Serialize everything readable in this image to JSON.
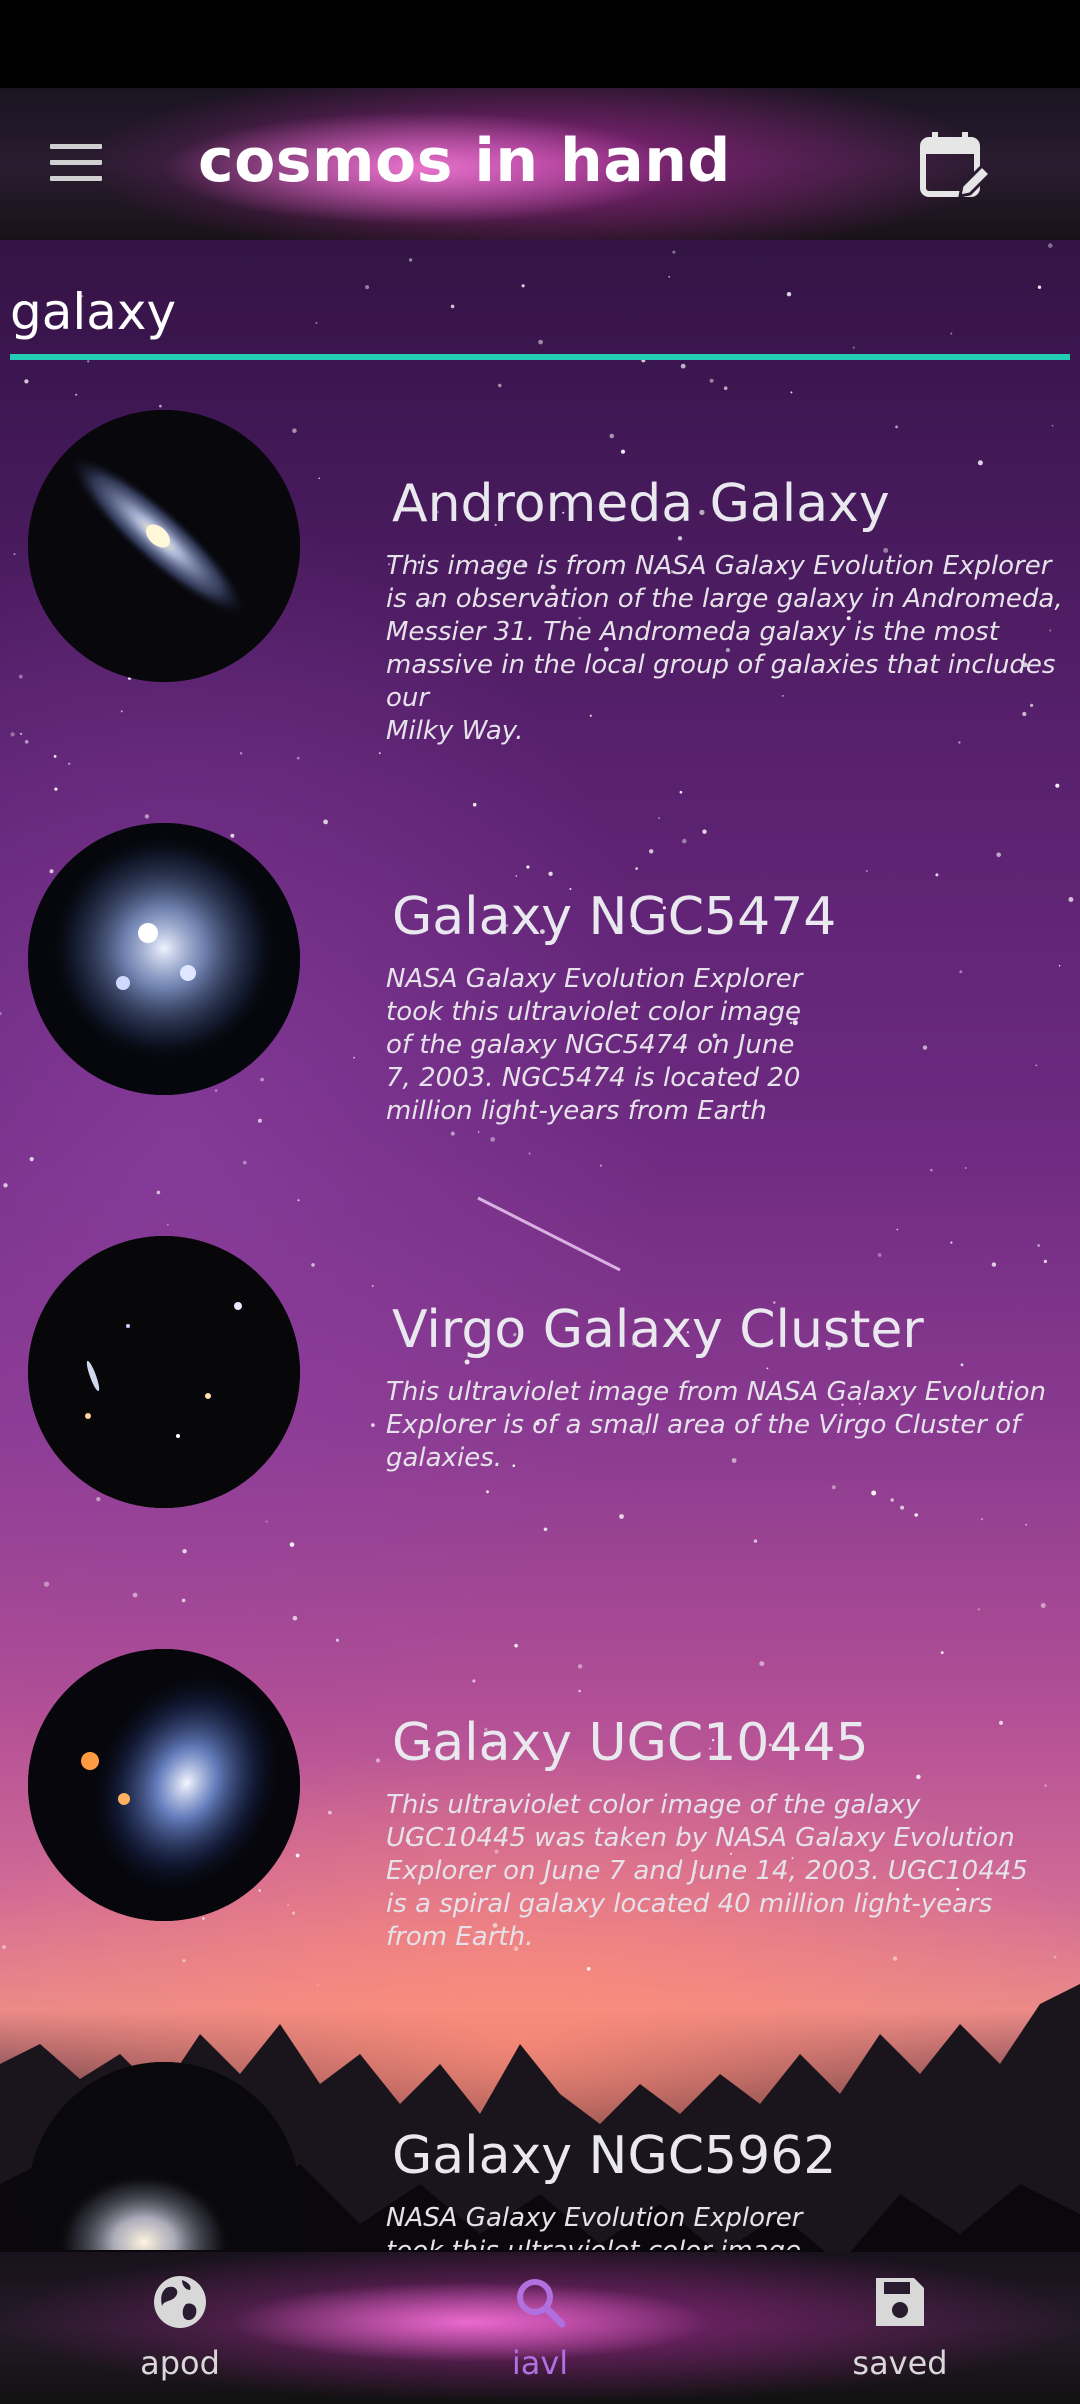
{
  "app": {
    "title": "cosmos in hand"
  },
  "search": {
    "value": "galaxy",
    "accent_color": "#22cdb4"
  },
  "results": [
    {
      "title": "Andromeda Galaxy",
      "description": "This image is from NASA Galaxy Evolution Explorer\nis an observation of the large galaxy in Andromeda,\nMessier 31. The Andromeda galaxy is the most\nmassive in the local group of galaxies that includes our\nMilky Way."
    },
    {
      "title": "Galaxy NGC5474",
      "description": "NASA Galaxy Evolution Explorer\ntook this ultraviolet color image\nof the galaxy NGC5474 on June\n7, 2003. NGC5474 is located 20\nmillion light-years from Earth"
    },
    {
      "title": "Virgo Galaxy Cluster",
      "description": "This ultraviolet image from NASA Galaxy Evolution\nExplorer is of a small area of the Virgo Cluster of\ngalaxies."
    },
    {
      "title": "Galaxy UGC10445",
      "description": "This ultraviolet color image of the galaxy\nUGC10445 was taken by NASA Galaxy Evolution\nExplorer on June 7 and June 14, 2003. UGC10445\nis a spiral galaxy located 40 million light-years\nfrom Earth."
    },
    {
      "title": "Galaxy NGC5962",
      "description": "NASA Galaxy Evolution Explorer\ntook this ultraviolet color image"
    }
  ],
  "bottom_nav": {
    "items": [
      {
        "label": "apod",
        "icon": "globe-icon"
      },
      {
        "label": "iavl",
        "icon": "search-icon",
        "active": true
      },
      {
        "label": "saved",
        "icon": "floppy-disk-icon"
      }
    ],
    "active_color": "#b070e0"
  }
}
